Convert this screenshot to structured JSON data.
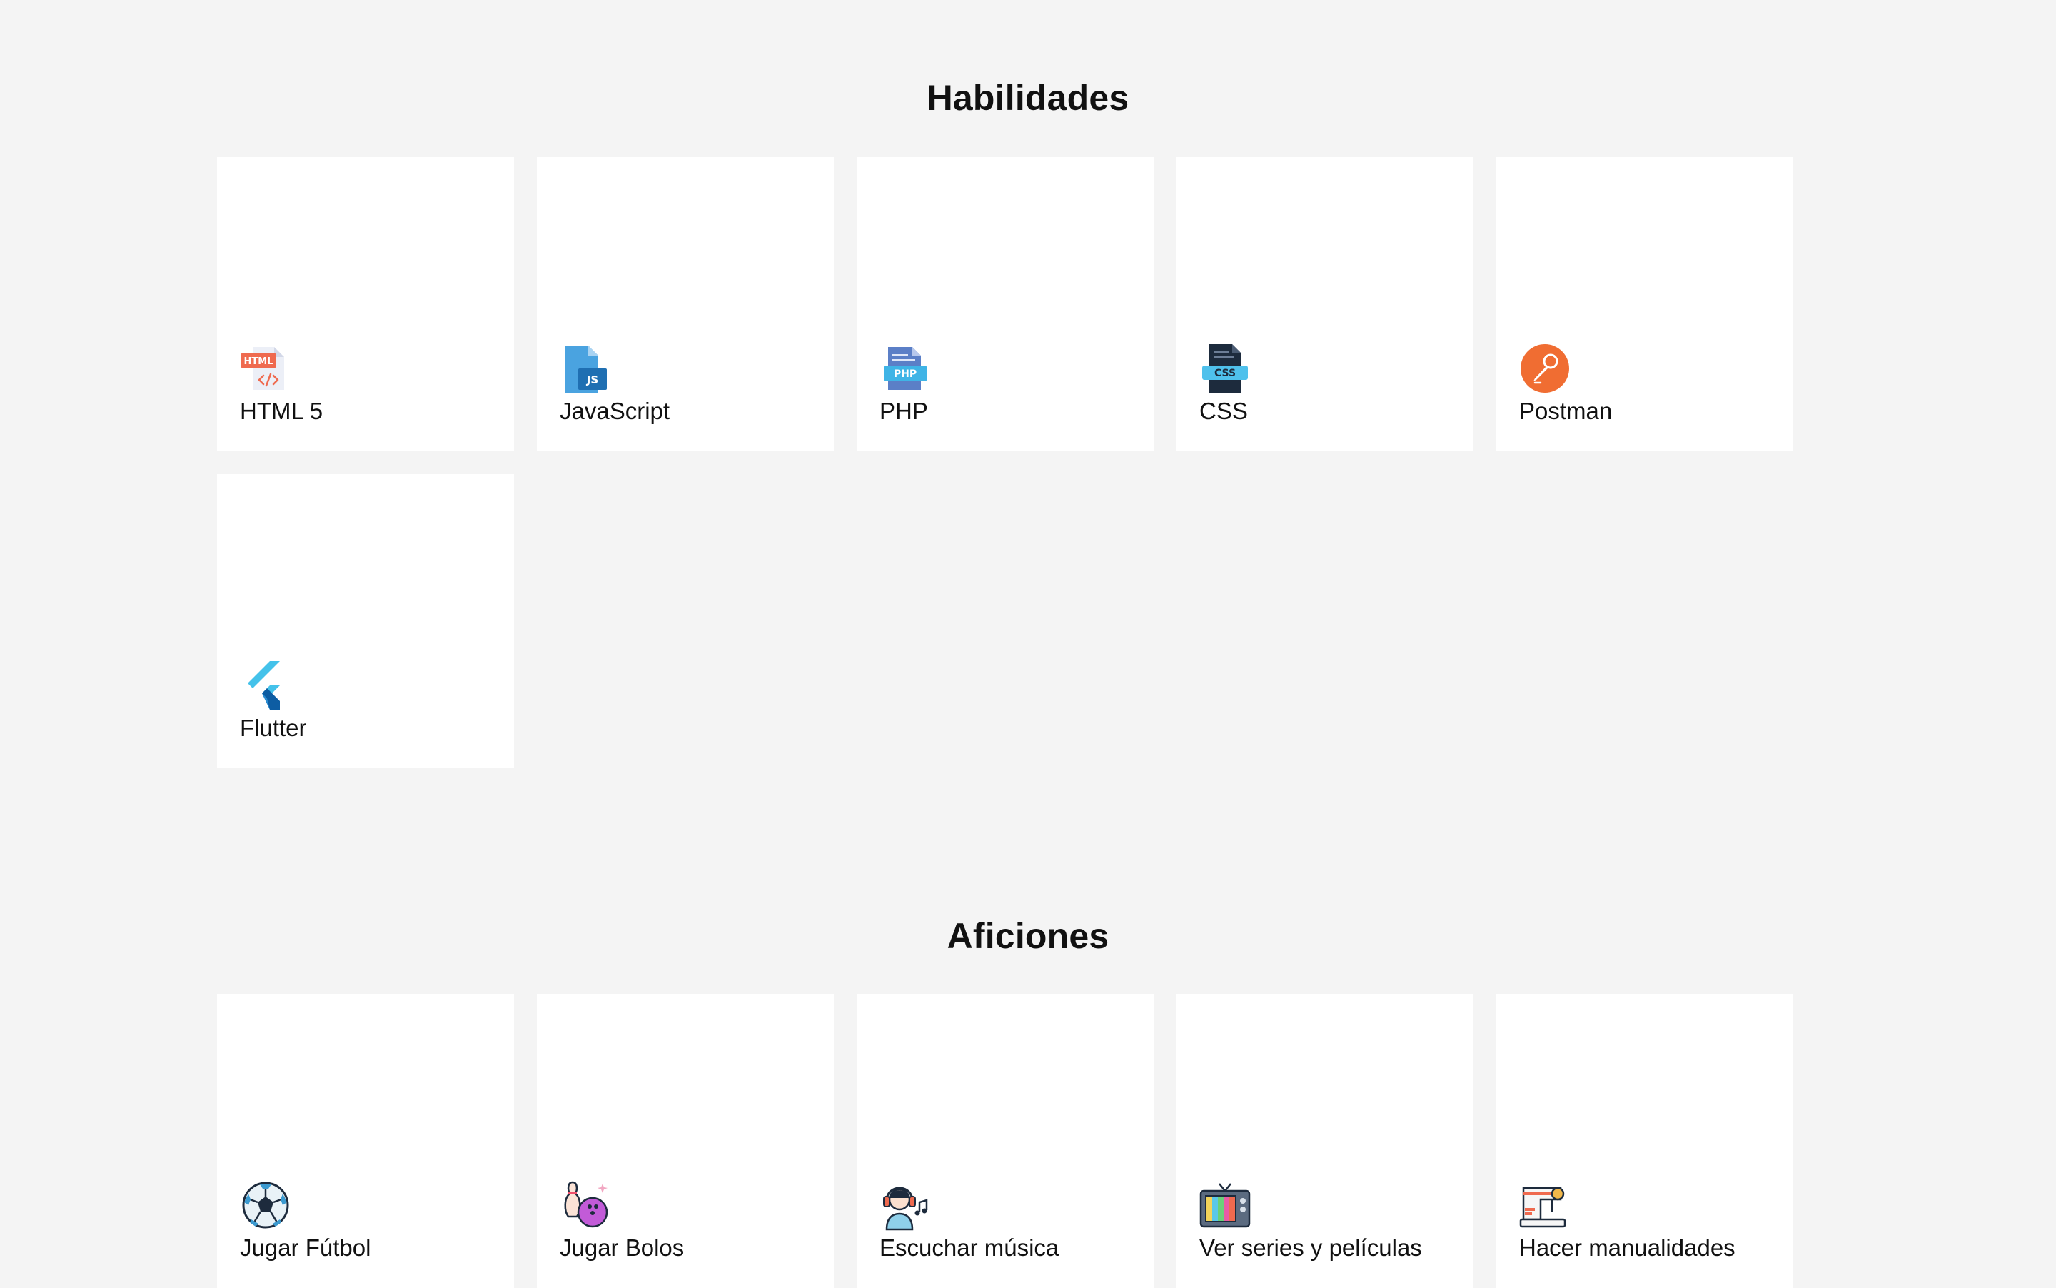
{
  "skills": {
    "title": "Habilidades",
    "items": [
      {
        "label": "HTML 5",
        "icon": "html5-file-icon"
      },
      {
        "label": "JavaScript",
        "icon": "javascript-file-icon"
      },
      {
        "label": "PHP",
        "icon": "php-file-icon"
      },
      {
        "label": "CSS",
        "icon": "css-file-icon"
      },
      {
        "label": "Postman",
        "icon": "postman-logo-icon"
      },
      {
        "label": "Flutter",
        "icon": "flutter-logo-icon"
      }
    ]
  },
  "hobbies": {
    "title": "Aficiones",
    "items": [
      {
        "label": "Jugar Fútbol",
        "icon": "soccer-ball-icon"
      },
      {
        "label": "Jugar Bolos",
        "icon": "bowling-icon"
      },
      {
        "label": "Escuchar música",
        "icon": "headphones-person-icon"
      },
      {
        "label": "Ver series y películas",
        "icon": "retro-tv-icon"
      },
      {
        "label": "Hacer manualidades",
        "icon": "sewing-machine-icon"
      }
    ]
  },
  "colors": {
    "background": "#f4f4f4",
    "card": "#ffffff",
    "text": "#111111",
    "html_orange": "#ef6a4f",
    "js_blue": "#2f8fd2",
    "php_blue": "#5b7fc7",
    "css_dark": "#1d2b3d",
    "postman_orange": "#f06d32",
    "flutter_blue": "#44c2ea"
  }
}
